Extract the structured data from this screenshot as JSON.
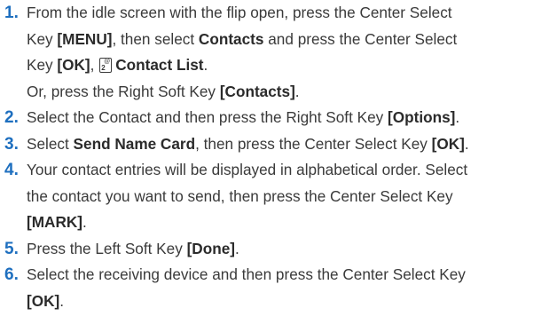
{
  "steps": [
    {
      "number": "1.",
      "l1_a": "From the idle screen with the flip open, press the Center Select",
      "l2_a": "Key ",
      "l2_b": "[MENU]",
      "l2_c": ", then select ",
      "l2_d": "Contacts",
      "l2_e": " and press the Center Select",
      "l3_a": "Key ",
      "l3_b": "[OK]",
      "l3_c": ", ",
      "l3_icon_digit": "2",
      "l3_icon_letters": "@",
      "l3_d": "Contact List",
      "l3_e": ".",
      "l4_a": "Or, press the Right Soft Key ",
      "l4_b": "[Contacts]",
      "l4_c": "."
    },
    {
      "number": "2.",
      "l1_a": "Select the Contact and then press the Right Soft Key ",
      "l1_b": "[Options]",
      "l1_c": "."
    },
    {
      "number": "3.",
      "l1_a": "Select ",
      "l1_b": "Send Name Card",
      "l1_c": ", then press the Center Select Key ",
      "l1_d": "[OK]",
      "l1_e": "."
    },
    {
      "number": "4.",
      "l1_a": "Your contact entries will be displayed in alphabetical order. Select",
      "l2_a": "the contact you want to send, then press the Center Select Key",
      "l3_a": "[MARK]",
      "l3_b": "."
    },
    {
      "number": "5.",
      "l1_a": "Press the Left Soft Key ",
      "l1_b": "[Done]",
      "l1_c": "."
    },
    {
      "number": "6.",
      "l1_a": "Select the receiving device and then press the Center Select Key",
      "l2_a": "[OK]",
      "l2_b": "."
    }
  ],
  "icons": {
    "contact_list_key": "key-2-icon"
  },
  "colors": {
    "number": "#1e6fbf",
    "text": "#3a3a3a"
  }
}
